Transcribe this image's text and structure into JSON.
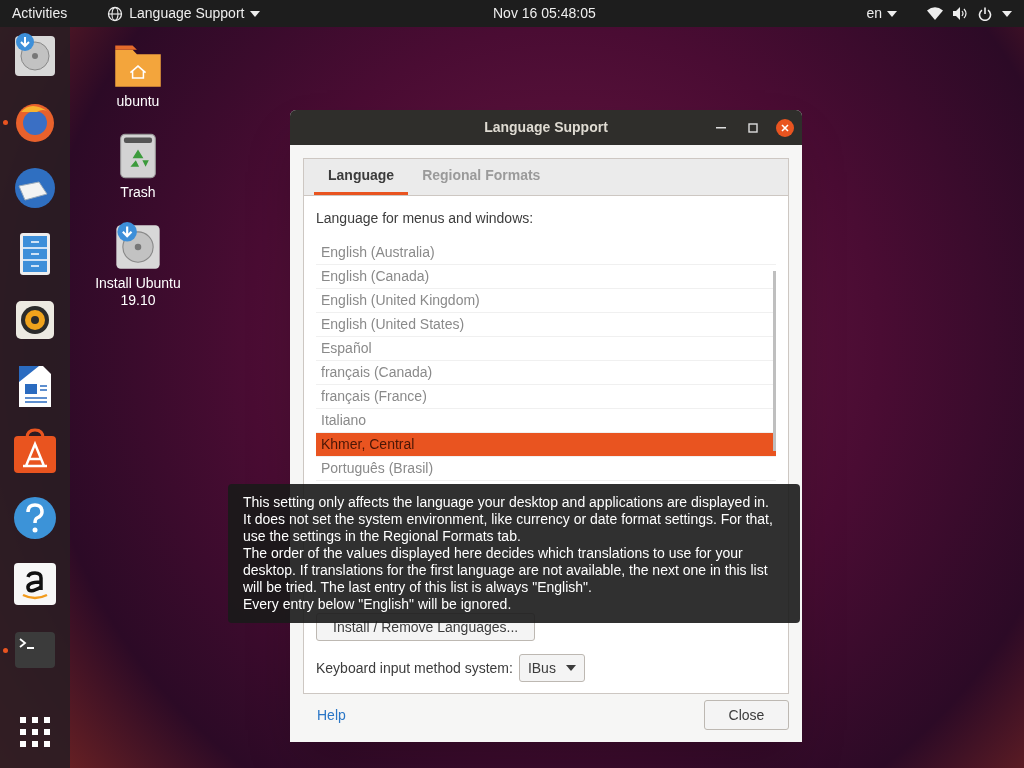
{
  "top_bar": {
    "activities": "Activities",
    "app_menu": "Language Support",
    "clock": "Nov 16  05:48:05",
    "input_language": "en"
  },
  "dock": [
    {
      "kind": "installer",
      "running": false
    },
    {
      "kind": "browser",
      "running": true
    },
    {
      "kind": "mail",
      "running": false
    },
    {
      "kind": "files",
      "running": false
    },
    {
      "kind": "music",
      "running": false
    },
    {
      "kind": "writer",
      "running": false
    },
    {
      "kind": "store",
      "running": false
    },
    {
      "kind": "help",
      "running": false
    },
    {
      "kind": "amazon",
      "running": false
    },
    {
      "kind": "terminal",
      "running": true
    },
    {
      "kind": "apps",
      "running": false
    }
  ],
  "desktop_icons": [
    {
      "kind": "folder",
      "label": "ubuntu"
    },
    {
      "kind": "trash",
      "label": "Trash"
    },
    {
      "kind": "installer",
      "label": "Install Ubuntu 19.10"
    }
  ],
  "dialog": {
    "title": "Language Support",
    "tabs": [
      {
        "label": "Language",
        "selected": true
      },
      {
        "label": "Regional Formats",
        "selected": false
      }
    ],
    "list_label": "Language for menus and windows:",
    "languages": [
      {
        "label": "English (Australia)",
        "selected": false
      },
      {
        "label": "English (Canada)",
        "selected": false
      },
      {
        "label": "English (United Kingdom)",
        "selected": false
      },
      {
        "label": "English (United States)",
        "selected": false
      },
      {
        "label": "Español",
        "selected": false
      },
      {
        "label": "français (Canada)",
        "selected": false
      },
      {
        "label": "français (France)",
        "selected": false
      },
      {
        "label": "Italiano",
        "selected": false
      },
      {
        "label": "Khmer, Central",
        "selected": true
      },
      {
        "label": "Português (Brasil)",
        "selected": false
      }
    ],
    "install_button": "Install / Remove Languages...",
    "keyboard_label": "Keyboard input method system:",
    "keyboard_value": "IBus",
    "help_button": "Help",
    "close_button": "Close"
  },
  "tooltip": [
    "This setting only affects the language your desktop and applications are displayed in. It does not set the system environment, like currency or date format settings. For that, use the settings in the Regional Formats tab.",
    "The order of the values displayed here decides which translations to use for your desktop. If translations for the first language are not available, the next one in this list will be tried. The last entry of this list is always \"English\".",
    "Every entry below \"English\" will be ignored."
  ]
}
